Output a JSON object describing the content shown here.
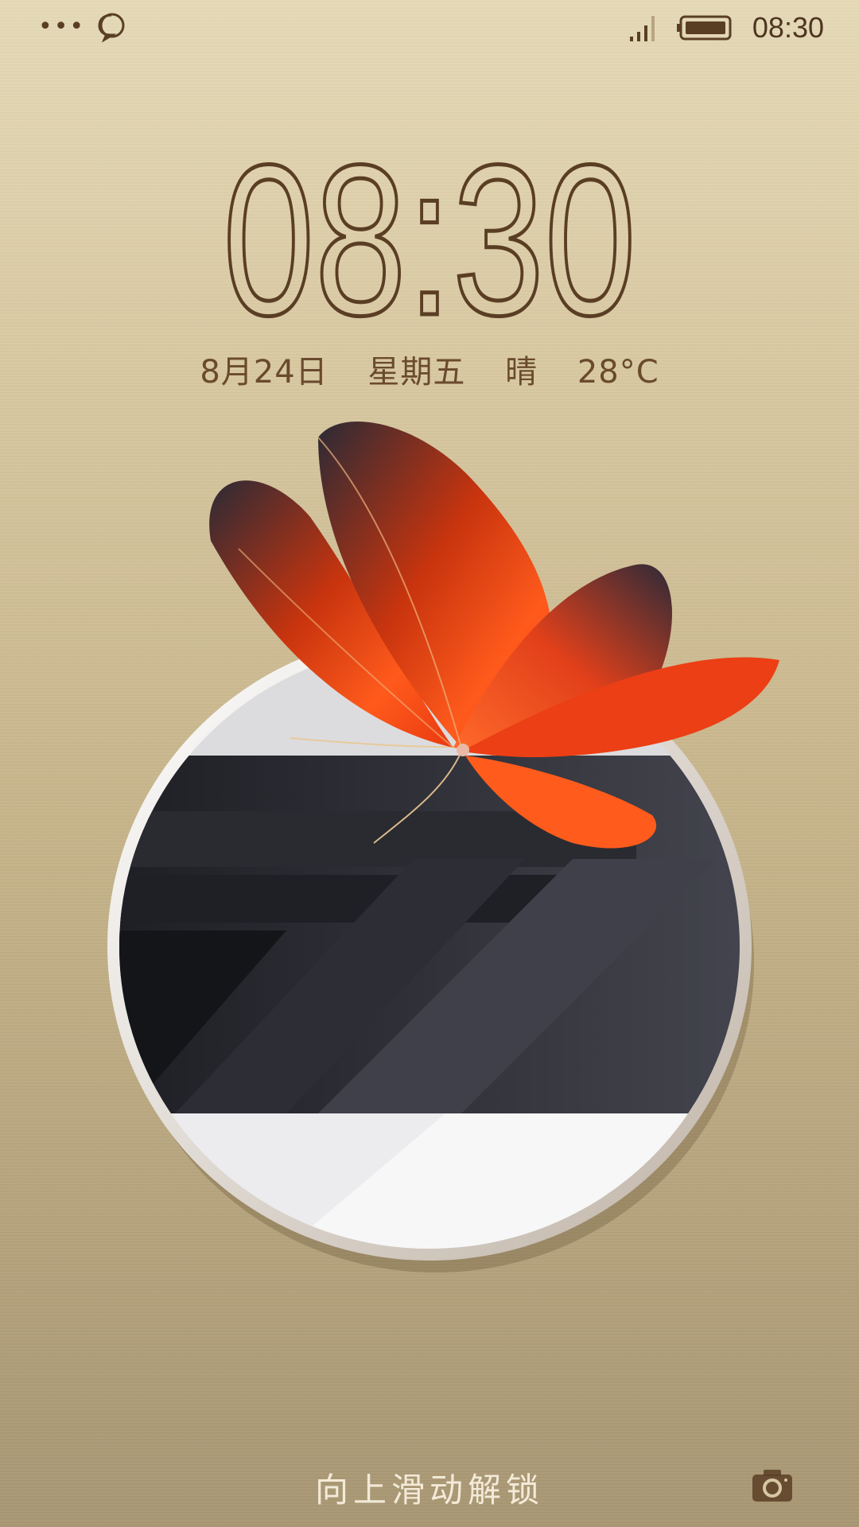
{
  "status_bar": {
    "more_icon": "more-dots-icon",
    "message_icon": "chat-bubble-icon",
    "signal_icon": "signal-icon",
    "battery_icon": "battery-icon",
    "time": "08:30"
  },
  "clock": {
    "time": "08:30"
  },
  "date_info": {
    "date": "8月24日",
    "weekday": "星期五",
    "weather": "晴",
    "temperature": "28°C"
  },
  "unlock_hint": "向上滑动解锁",
  "camera_icon": "camera-icon",
  "colors": {
    "accent": "#5a3e24",
    "wing": "#e8431a",
    "background": "#d6c59c"
  }
}
